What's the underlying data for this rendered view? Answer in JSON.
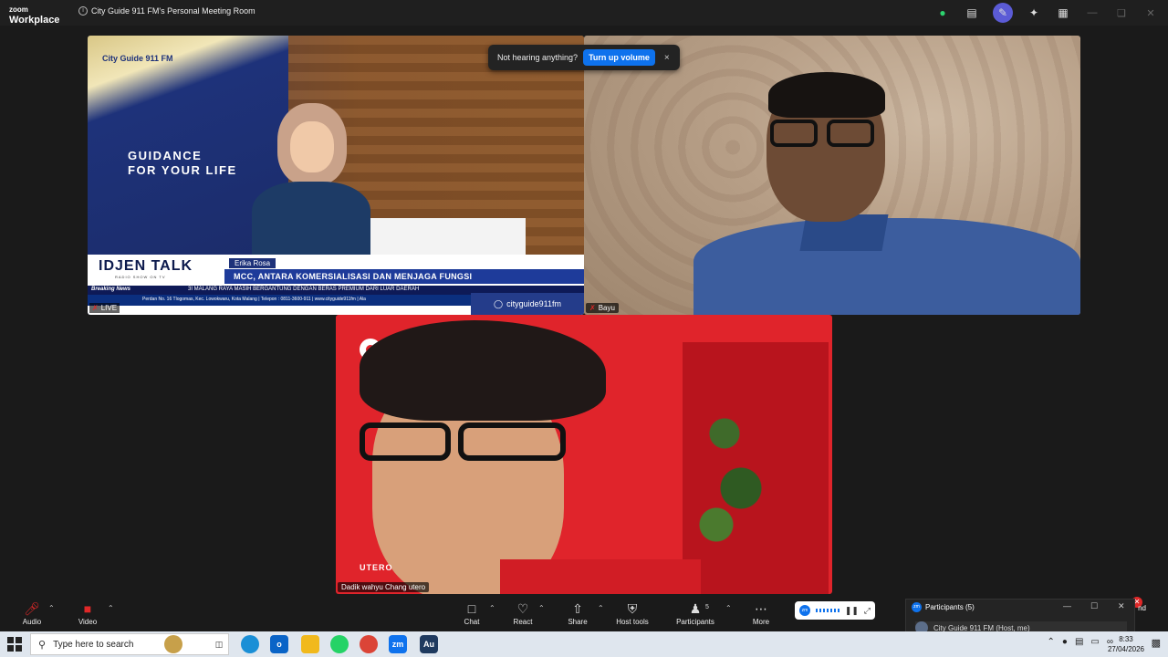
{
  "app": {
    "brand_small": "zoom",
    "brand_large": "Workplace",
    "meeting_title": "City Guide 911 FM's Personal Meeting Room"
  },
  "toast": {
    "message": "Not hearing anything?",
    "button": "Turn up volume",
    "close": "×"
  },
  "tiles": {
    "studio": {
      "logo": "City Guide 911 FM",
      "guidance_1": "GUIDANCE",
      "guidance_2": "FOR YOUR LIFE",
      "show_title": "IDJEN TALK",
      "show_sub": "RADIO SHOW ON TV",
      "guest_name": "Erika Rosa",
      "headline": "MCC, ANTARA KOMERSIALISASI DAN MENJAGA FUNGSI",
      "breaking_label": "Breaking News",
      "breaking_text": "3I MALANG RAYA MASIH BERGANTUNG DENGAN BERAS PREMIUM DARI LUAR DAERAH",
      "address": "Perdan No. 16 Tlogomas, Kec. Lowokwaru, Kota Malang | Telepon : 0811-3600-911 | www.cityguide911fm | Ala",
      "instagram": "cityguide911fm",
      "tile_label": "LIVE"
    },
    "bayu": {
      "name": "Bayu"
    },
    "dadik": {
      "name": "Dadik wahyu Chang utero",
      "brand": "UTERO"
    }
  },
  "toolbar": {
    "audio": "Audio",
    "video": "Video",
    "chat": "Chat",
    "react": "React",
    "share": "Share",
    "host_tools": "Host tools",
    "participants": "Participants",
    "participants_count": "5",
    "more": "More",
    "end_fragment": "nd"
  },
  "participants_panel": {
    "title": "Participants (5)",
    "first_row": "City Guide 911 FM (Host, me)"
  },
  "taskbar": {
    "search_placeholder": "Type here to search",
    "time": "8:33",
    "date": "27/04/2026"
  },
  "colors": {
    "zoom_blue": "#0e72ed",
    "mute_red": "#e02828",
    "shield_green": "#2dd36f"
  }
}
